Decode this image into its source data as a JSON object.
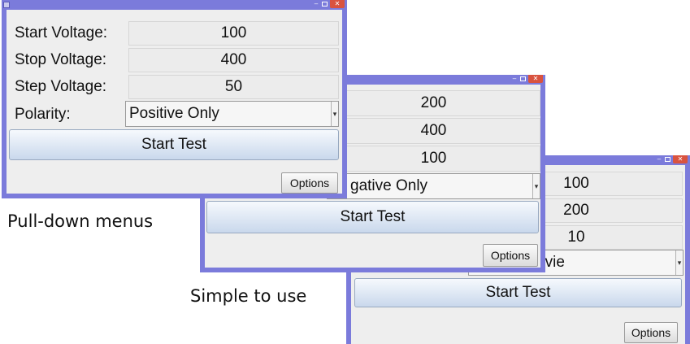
{
  "windows": [
    {
      "fields": [
        {
          "label": "Start Voltage:",
          "value": "100"
        },
        {
          "label": "Stop Voltage:",
          "value": "400"
        },
        {
          "label": "Step Voltage:",
          "value": "50"
        }
      ],
      "polarity_label": "Polarity:",
      "polarity_value": "Positive Only",
      "start_label": "Start Test",
      "options_label": "Options"
    },
    {
      "fields": [
        {
          "value": "200"
        },
        {
          "value": "400"
        },
        {
          "value": "100"
        }
      ],
      "polarity_value": "gative Only",
      "start_label": "Start Test",
      "options_label": "Options"
    },
    {
      "fields": [
        {
          "value": "100"
        },
        {
          "value": "200"
        },
        {
          "value": "10"
        }
      ],
      "polarity_value": "hen Negatvie",
      "start_label": "Start Test",
      "options_label": "Options"
    }
  ],
  "captions": {
    "pulldown": "Pull-down menus",
    "simple": "Simple to use"
  },
  "colors": {
    "window_frame": "#7b7bdb",
    "close_button": "#d9533f",
    "panel_background": "#eeeeee"
  }
}
